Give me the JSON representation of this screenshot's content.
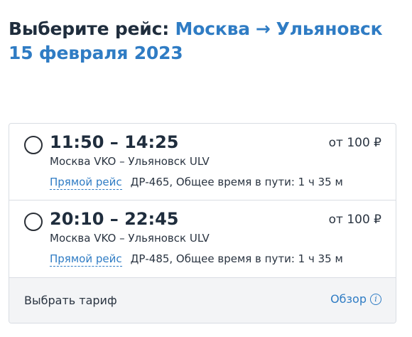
{
  "header": {
    "title_prefix": "Выберите рейс:",
    "origin": "Москва",
    "arrow": "→",
    "destination": "Ульяновск",
    "date": "15 февраля 2023"
  },
  "flights": [
    {
      "times": "11:50 – 14:25",
      "price": "от 100 ₽",
      "route": "Москва VKO – Ульяновск ULV",
      "direct_label": "Прямой рейс",
      "details": "ДР-465, Общее время в пути: 1 ч 35 м",
      "selected": false
    },
    {
      "times": "20:10 – 22:45",
      "price": "от 100 ₽",
      "route": "Москва VKO – Ульяновск ULV",
      "direct_label": "Прямой рейс",
      "details": "ДР-485, Общее время в пути: 1 ч 35 м",
      "selected": false
    }
  ],
  "footer": {
    "tariff_label": "Выбрать тариф",
    "overview_label": "Обзор",
    "info_icon": "i"
  },
  "colors": {
    "accent": "#2f7cc4",
    "text": "#1f2d3d",
    "border": "#d9dde3",
    "footer_bg": "#f3f4f6"
  }
}
